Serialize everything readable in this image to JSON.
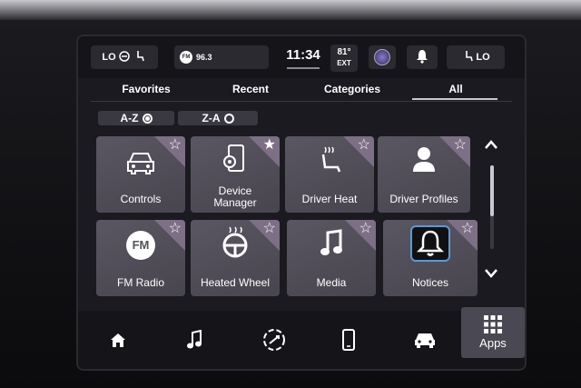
{
  "status": {
    "left_pill": {
      "temp_label": "LO"
    },
    "radio": {
      "badge": "FM",
      "station": "96.3"
    },
    "clock": "11:34",
    "outside_temp": {
      "value": "81°",
      "label": "EXT"
    },
    "right_pill": {
      "temp_label": "LO"
    }
  },
  "tabs": [
    {
      "label": "Favorites"
    },
    {
      "label": "Recent"
    },
    {
      "label": "Categories"
    },
    {
      "label": "All",
      "selected": true
    }
  ],
  "sort": {
    "az": {
      "label": "A-Z",
      "selected": true
    },
    "za": {
      "label": "Z-A",
      "selected": false
    }
  },
  "apps": [
    {
      "label": "Controls",
      "icon": "car-front-icon"
    },
    {
      "label": "Device\nManager",
      "icon": "phone-gear-icon"
    },
    {
      "label": "Driver Heat",
      "icon": "heated-seat-icon"
    },
    {
      "label": "Driver Profiles",
      "icon": "person-icon"
    },
    {
      "label": "FM Radio",
      "icon": "fm-icon",
      "icon_text": "FM"
    },
    {
      "label": "Heated Wheel",
      "icon": "heated-wheel-icon"
    },
    {
      "label": "Media",
      "icon": "music-note-icon"
    },
    {
      "label": "Notices",
      "icon": "bell-icon"
    }
  ],
  "bottom_nav": {
    "items": [
      {
        "name": "home",
        "icon": "home-icon"
      },
      {
        "name": "media",
        "icon": "music-note-icon"
      },
      {
        "name": "comfort",
        "icon": "climate-icon"
      },
      {
        "name": "phone",
        "icon": "phone-icon"
      },
      {
        "name": "vehicle",
        "icon": "car-icon"
      }
    ],
    "apps_label": "Apps"
  },
  "colors": {
    "tile": "#55525d",
    "corner": "#7d6f86",
    "screen_bg": "#1b1a20"
  }
}
